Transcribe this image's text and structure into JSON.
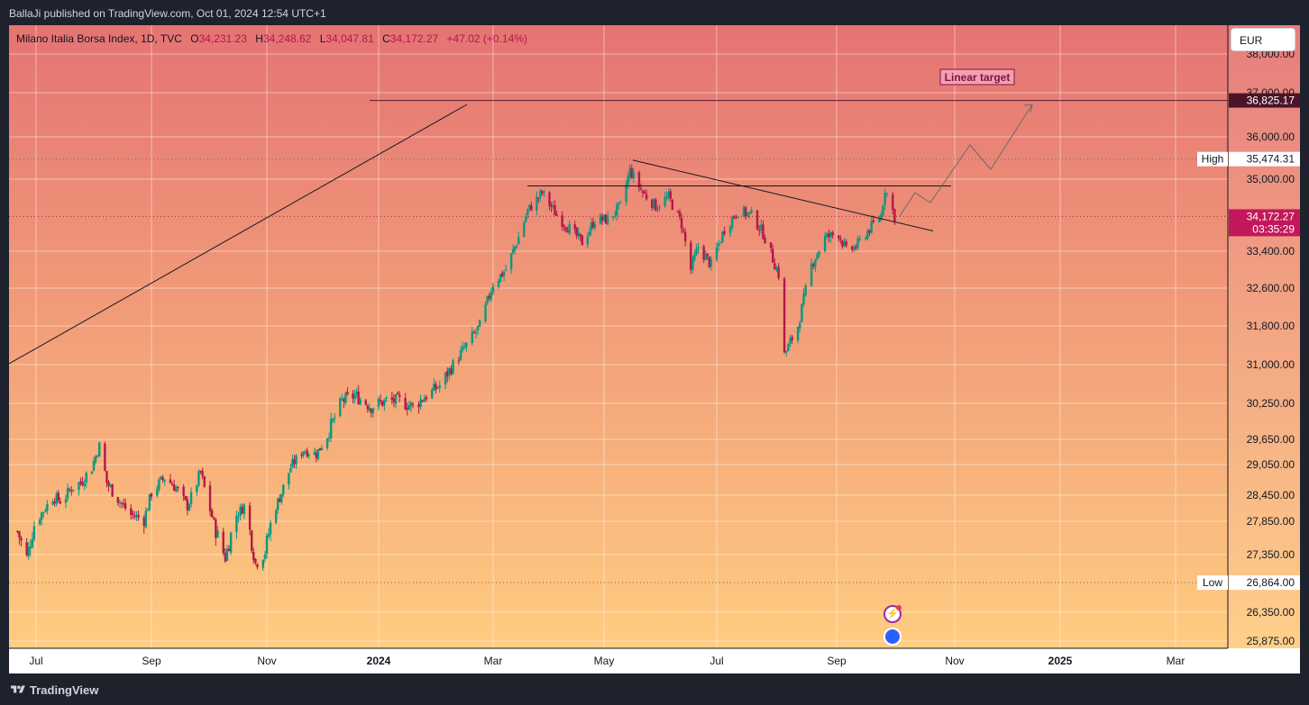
{
  "header": {
    "publisher": "BallaJi published on TradingView.com, Oct 01, 2024 12:54 UTC+1"
  },
  "legend": {
    "symbol": "Milano Italia Borsa Index, 1D, TVC",
    "o_label": "O",
    "o_value": "34,231.23",
    "h_label": "H",
    "h_value": "34,248.62",
    "l_label": "L",
    "l_value": "34,047.81",
    "c_label": "C",
    "c_value": "34,172.27",
    "change": "+47.02 (+0.14%)"
  },
  "currency": "EUR",
  "footer": {
    "brand": "TradingView"
  },
  "icons": {
    "bolt": "lightning-icon",
    "clock": "clock-icon",
    "logo": "tradingview-logo-icon"
  },
  "colors": {
    "up": "#089981",
    "down": "#b2184a",
    "bg_top": "#e57373",
    "bg_bottom": "#ffcc80",
    "price_label": "#c2185b"
  },
  "chart_data": {
    "type": "candlestick",
    "y_axis": {
      "ticks": [
        "38,000.00",
        "37,000.00",
        "36,000.00",
        "35,000.00",
        "33,400.00",
        "32,600.00",
        "31,800.00",
        "31,000.00",
        "30,250.00",
        "29,650.00",
        "29,050.00",
        "28,450.00",
        "27,850.00",
        "27,350.00",
        "26,350.00",
        "25,875.00"
      ],
      "ylim": [
        25800,
        38100
      ]
    },
    "x_axis": {
      "ticks": [
        "Jul",
        "Sep",
        "Nov",
        "2024",
        "Mar",
        "May",
        "Jul",
        "Sep",
        "Nov",
        "2025",
        "Mar"
      ],
      "tick_dates": [
        "2023-07",
        "2023-09",
        "2023-11",
        "2024-01",
        "2024-03",
        "2024-05",
        "2024-07",
        "2024-09",
        "2024-11",
        "2025-01",
        "2025-03"
      ]
    },
    "price_labels": {
      "target": "36,825.17",
      "high_label": "High",
      "high": "35,474.31",
      "low_label": "Low",
      "low": "26,864.00",
      "last": "34,172.27",
      "countdown": "03:35:29"
    },
    "annotation": "Linear target",
    "close_path": [
      [
        "2023-06-21",
        27700
      ],
      [
        "2023-06-26",
        27300
      ],
      [
        "2023-06-30",
        27800
      ],
      [
        "2023-07-05",
        28100
      ],
      [
        "2023-07-10",
        28400
      ],
      [
        "2023-07-15",
        28300
      ],
      [
        "2023-07-20",
        28600
      ],
      [
        "2023-07-25",
        28700
      ],
      [
        "2023-07-31",
        29000
      ],
      [
        "2023-08-04",
        29500
      ],
      [
        "2023-08-08",
        28700
      ],
      [
        "2023-08-15",
        28300
      ],
      [
        "2023-08-21",
        28000
      ],
      [
        "2023-08-28",
        27900
      ],
      [
        "2023-09-01",
        28500
      ],
      [
        "2023-09-08",
        28800
      ],
      [
        "2023-09-14",
        28600
      ],
      [
        "2023-09-20",
        28200
      ],
      [
        "2023-09-27",
        28900
      ],
      [
        "2023-10-04",
        27800
      ],
      [
        "2023-10-10",
        27300
      ],
      [
        "2023-10-16",
        28000
      ],
      [
        "2023-10-20",
        28200
      ],
      [
        "2023-10-26",
        27200
      ],
      [
        "2023-10-31",
        27400
      ],
      [
        "2023-11-06",
        28200
      ],
      [
        "2023-11-14",
        29000
      ],
      [
        "2023-11-21",
        29400
      ],
      [
        "2023-11-28",
        29300
      ],
      [
        "2023-12-05",
        29800
      ],
      [
        "2023-12-12",
        30300
      ],
      [
        "2023-12-19",
        30400
      ],
      [
        "2023-12-28",
        30200
      ],
      [
        "2024-01-05",
        30300
      ],
      [
        "2024-01-12",
        30300
      ],
      [
        "2024-01-19",
        30200
      ],
      [
        "2024-01-26",
        30400
      ],
      [
        "2024-02-02",
        30600
      ],
      [
        "2024-02-09",
        31000
      ],
      [
        "2024-02-16",
        31400
      ],
      [
        "2024-02-23",
        31800
      ],
      [
        "2024-03-01",
        32700
      ],
      [
        "2024-03-08",
        33000
      ],
      [
        "2024-03-14",
        33600
      ],
      [
        "2024-03-20",
        34300
      ],
      [
        "2024-03-28",
        34700
      ],
      [
        "2024-04-05",
        34200
      ],
      [
        "2024-04-12",
        33900
      ],
      [
        "2024-04-19",
        33600
      ],
      [
        "2024-04-26",
        34100
      ],
      [
        "2024-05-03",
        34100
      ],
      [
        "2024-05-10",
        34400
      ],
      [
        "2024-05-15",
        35200
      ],
      [
        "2024-05-22",
        34700
      ],
      [
        "2024-05-29",
        34400
      ],
      [
        "2024-06-05",
        34600
      ],
      [
        "2024-06-12",
        34000
      ],
      [
        "2024-06-17",
        33000
      ],
      [
        "2024-06-21",
        33500
      ],
      [
        "2024-06-28",
        33100
      ],
      [
        "2024-07-05",
        33900
      ],
      [
        "2024-07-12",
        34300
      ],
      [
        "2024-07-19",
        34200
      ],
      [
        "2024-07-25",
        33800
      ],
      [
        "2024-08-02",
        32900
      ],
      [
        "2024-08-05",
        31200
      ],
      [
        "2024-08-12",
        31800
      ],
      [
        "2024-08-19",
        33100
      ],
      [
        "2024-08-26",
        33700
      ],
      [
        "2024-09-02",
        33800
      ],
      [
        "2024-09-06",
        33400
      ],
      [
        "2024-09-11",
        33500
      ],
      [
        "2024-09-18",
        33900
      ],
      [
        "2024-09-24",
        34200
      ],
      [
        "2024-09-26",
        34800
      ],
      [
        "2024-10-01",
        34172
      ]
    ]
  }
}
